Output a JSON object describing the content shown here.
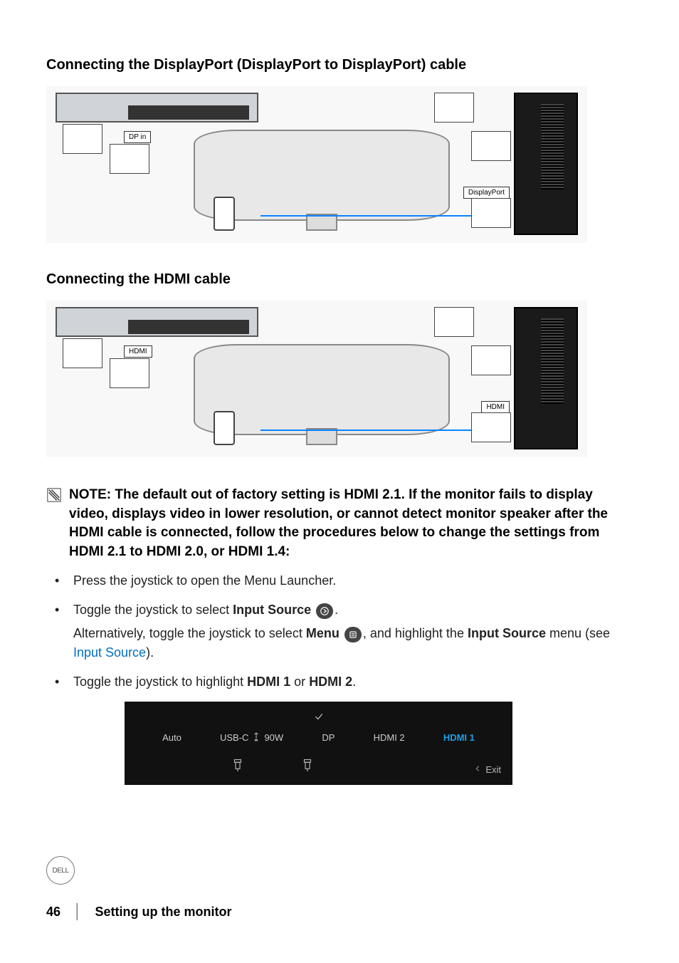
{
  "headings": {
    "dp": "Connecting the DisplayPort (DisplayPort to DisplayPort) cable",
    "hdmi": "Connecting the HDMI cable"
  },
  "diagram_labels": {
    "dp_in": "DP in",
    "displayport": "DisplayPort",
    "hdmi_left": "HDMI",
    "hdmi_right": "HDMI"
  },
  "note": {
    "text": "NOTE: The default out of factory setting is HDMI 2.1. If the monitor fails to display video, displays video in lower resolution, or cannot detect monitor speaker after the HDMI cable is connected, follow the procedures below to change the settings from HDMI 2.1 to HDMI 2.0, or HDMI 1.4:"
  },
  "steps": {
    "s1": "Press the joystick to open the Menu Launcher.",
    "s2_pre": "Toggle the joystick to select ",
    "s2_bold": "Input Source",
    "s2_post": ".",
    "s2b_pre": "Alternatively, toggle the joystick to select ",
    "s2b_bold": "Menu",
    "s2b_mid": ", and highlight the ",
    "s2b_bold2": "Input Source",
    "s2b_post": " menu (see ",
    "s2b_link": "Input Source",
    "s2b_end": ").",
    "s3_pre": "Toggle the joystick to highlight ",
    "s3_b1": "HDMI 1",
    "s3_mid": " or ",
    "s3_b2": "HDMI 2",
    "s3_post": "."
  },
  "osd": {
    "items": {
      "auto": "Auto",
      "usbc": "USB-C",
      "usbc_watt": "90W",
      "dp": "DP",
      "hdmi2": "HDMI 2",
      "hdmi1": "HDMI 1"
    },
    "exit": "Exit"
  },
  "footer": {
    "page": "46",
    "separator": "│",
    "title": "Setting up the monitor"
  },
  "brand": "DELL"
}
